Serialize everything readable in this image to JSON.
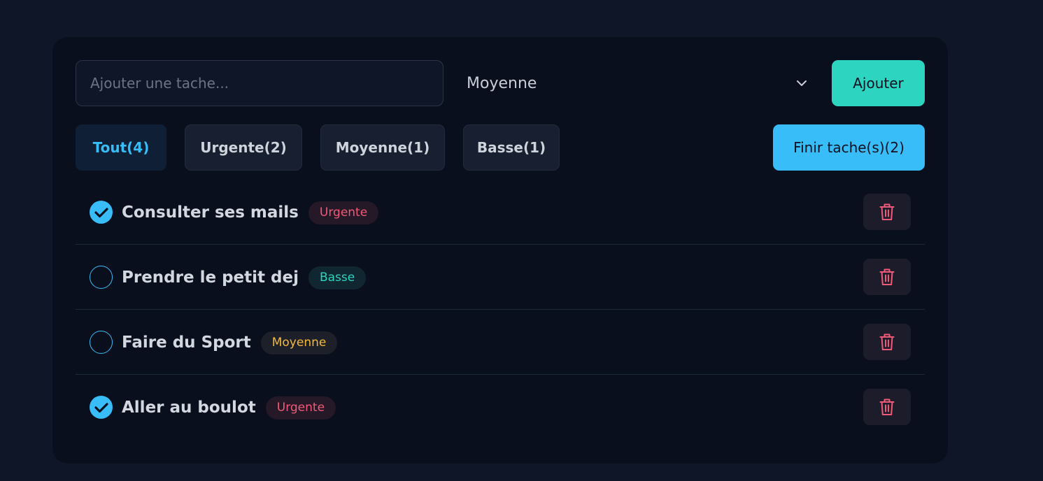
{
  "add_form": {
    "input_placeholder": "Ajouter une tache...",
    "input_value": "",
    "priority_selected": "Moyenne",
    "add_label": "Ajouter"
  },
  "filters": [
    {
      "label": "Tout(4)",
      "active": true
    },
    {
      "label": "Urgente(2)",
      "active": false
    },
    {
      "label": "Moyenne(1)",
      "active": false
    },
    {
      "label": "Basse(1)",
      "active": false
    }
  ],
  "finish_label": "Finir tache(s)(2)",
  "tasks": [
    {
      "title": "Consulter ses mails",
      "priority": "Urgente",
      "done": true
    },
    {
      "title": "Prendre le petit dej",
      "priority": "Basse",
      "done": false
    },
    {
      "title": "Faire du Sport",
      "priority": "Moyenne",
      "done": false
    },
    {
      "title": "Aller au boulot",
      "priority": "Urgente",
      "done": true
    }
  ],
  "icons": {
    "check": "check-icon",
    "delete": "trash-icon",
    "select": "chevron-down-icon"
  },
  "colors": {
    "background": "#0f1628",
    "card": "#0a0f1d",
    "accent_teal": "#2dd4bf",
    "accent_blue": "#38bdf8",
    "urgente": "#f05a78",
    "basse": "#2dd4bf",
    "moyenne": "#f5b93a"
  }
}
